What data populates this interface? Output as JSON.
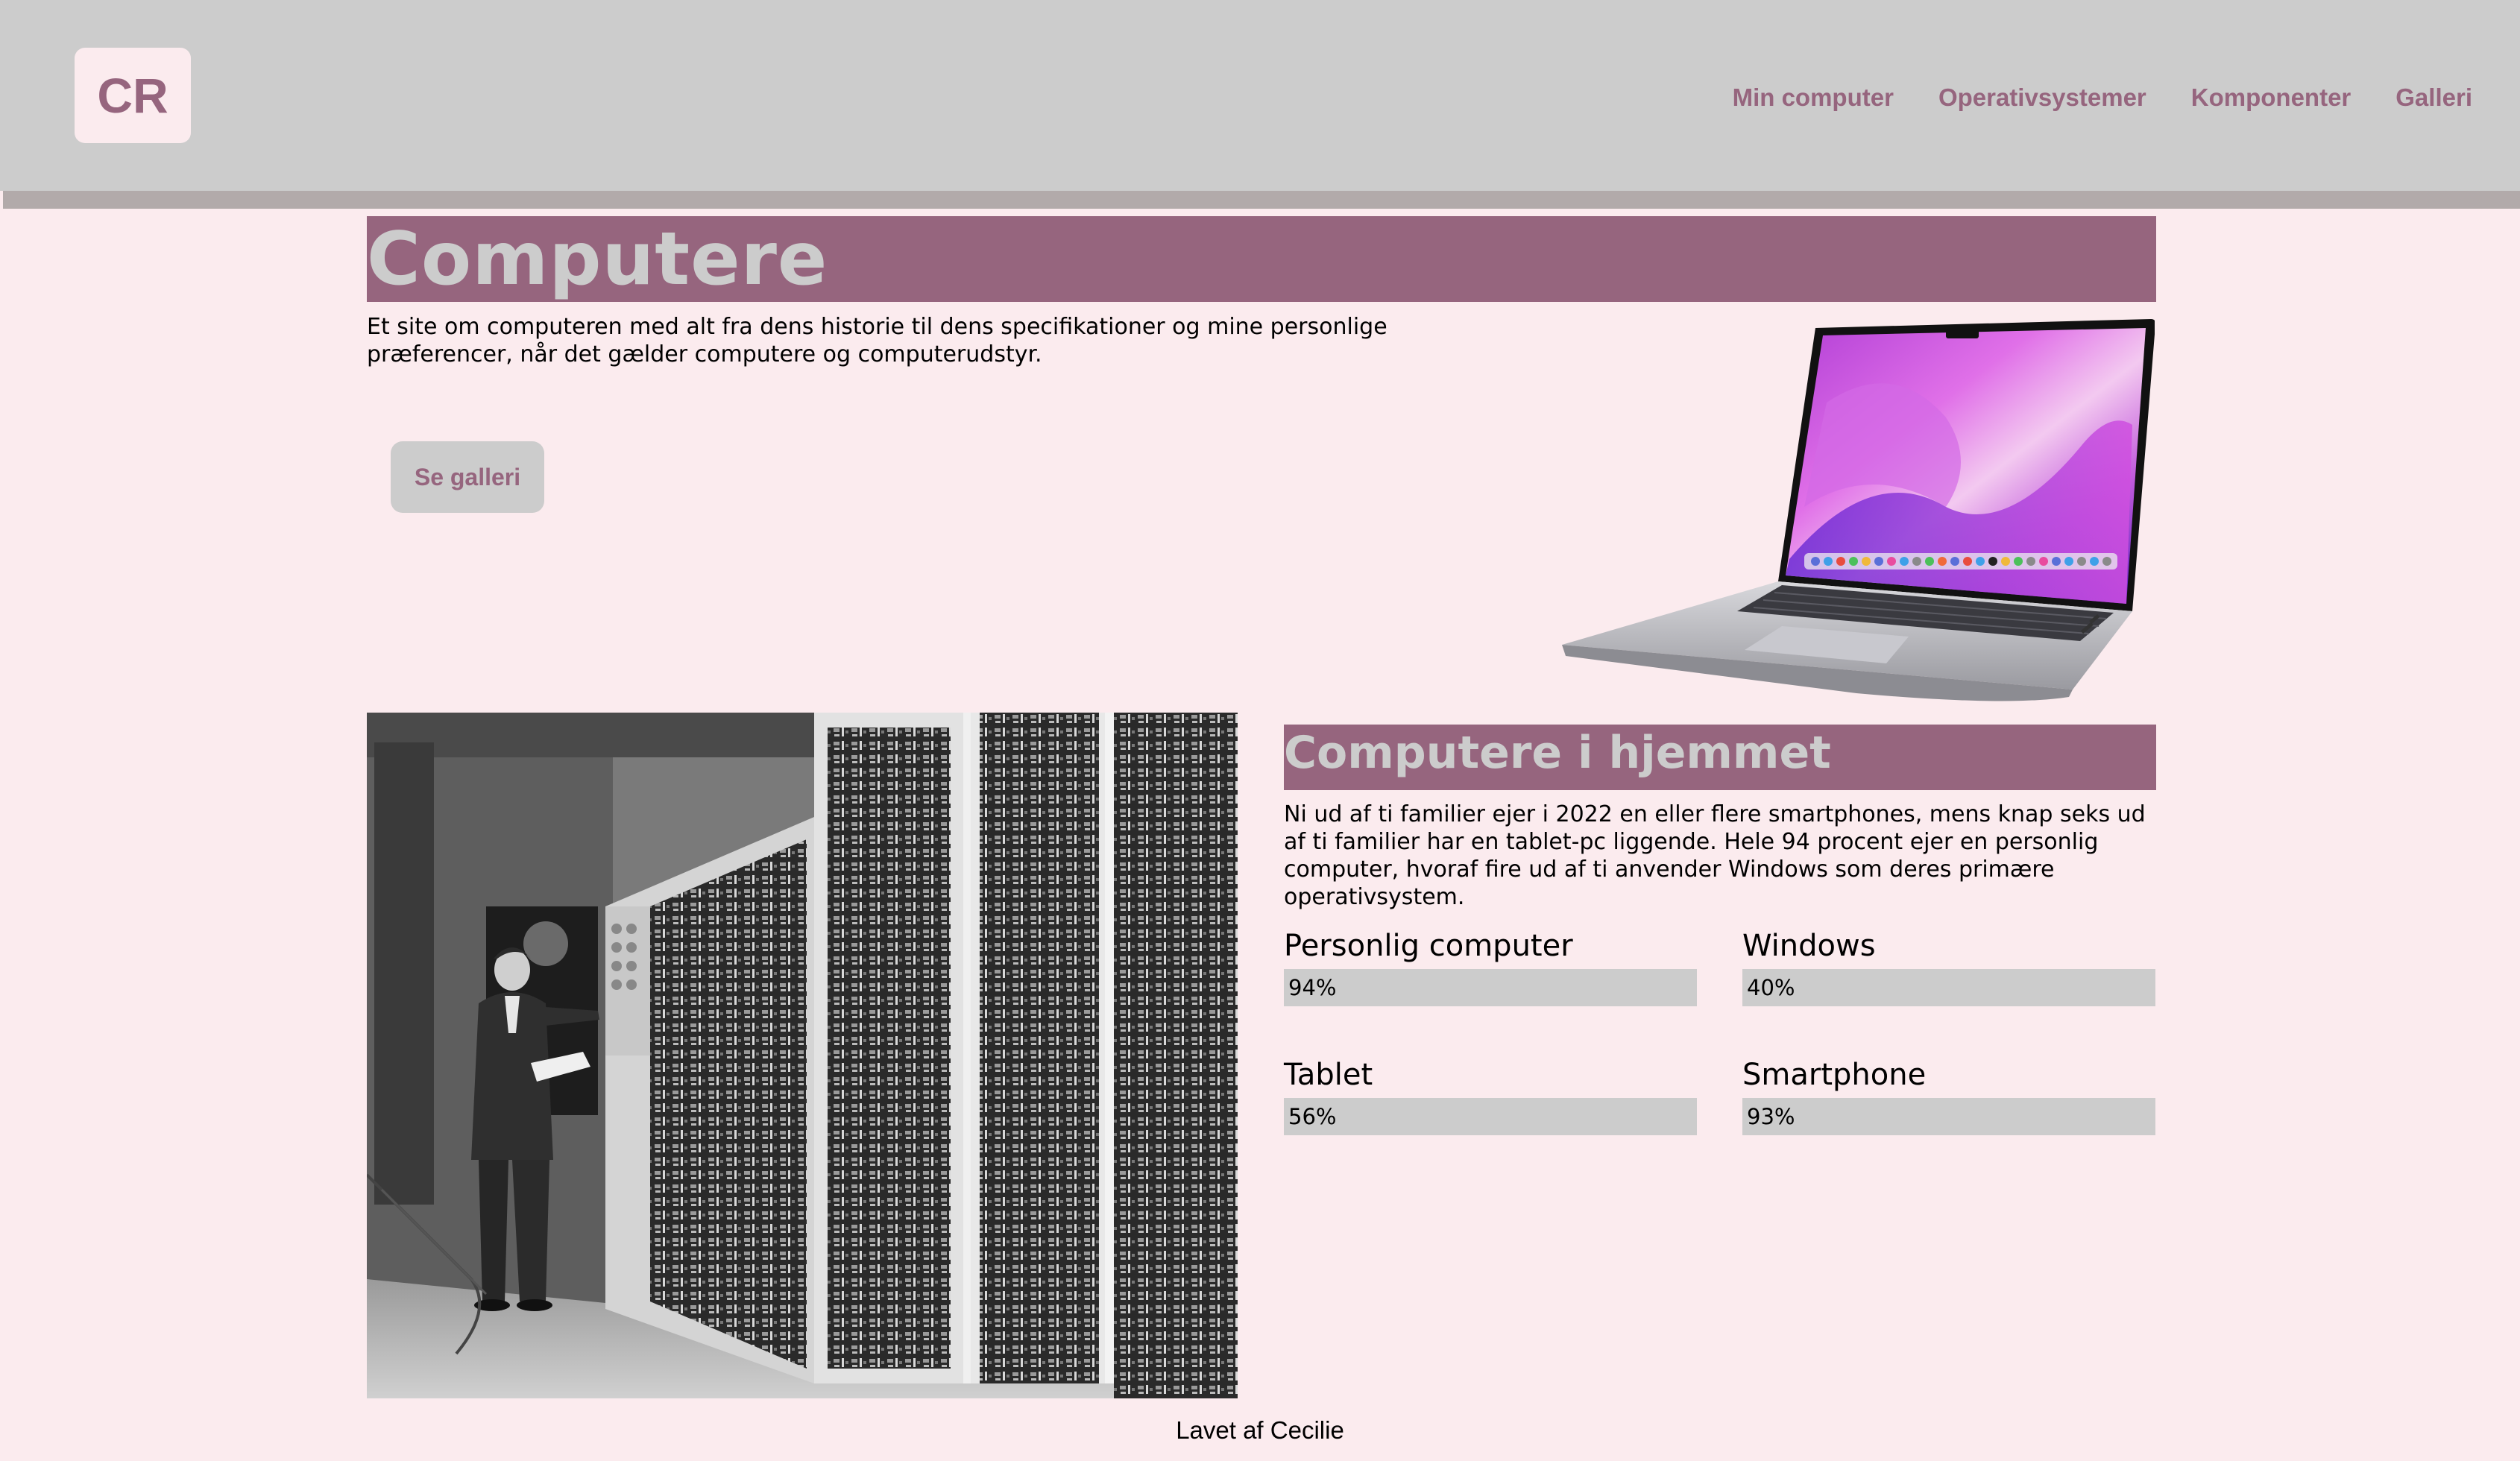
{
  "header": {
    "logo": "CR",
    "nav": [
      {
        "label": "Min computer"
      },
      {
        "label": "Operativsystemer"
      },
      {
        "label": "Komponenter"
      },
      {
        "label": "Galleri"
      }
    ]
  },
  "hero": {
    "title": "Computere",
    "intro": "Et site om computeren med alt fra dens historie til dens specifikationer og mine personlige præferencer, når det gælder computere og computerudstyr.",
    "button_label": "Se galleri"
  },
  "home_section": {
    "title": "Computere i hjemmet",
    "text": "Ni ud af ti familier ejer i 2022 en eller flere smartphones, mens knap seks ud af ti familier har en tablet-pc liggende. Hele 94 procent ejer en personlig computer, hvoraf fire ud af ti anvender Windows som deres primære operativsystem.",
    "stats": [
      {
        "label": "Personlig computer",
        "value_text": "94%",
        "value": 94
      },
      {
        "label": "Windows",
        "value_text": "40%",
        "value": 40
      },
      {
        "label": "Tablet",
        "value_text": "56%",
        "value": 56
      },
      {
        "label": "Smartphone",
        "value_text": "93%",
        "value": 93
      }
    ]
  },
  "footer": {
    "text": "Lavet af Cecilie"
  },
  "colors": {
    "accent": "#96657e",
    "header_bg": "#cccccc",
    "page_bg": "#fbebee",
    "strip": "#b2aaaa"
  },
  "icons": {
    "laptop": "laptop-image",
    "vintage": "vintage-computer-photo"
  }
}
